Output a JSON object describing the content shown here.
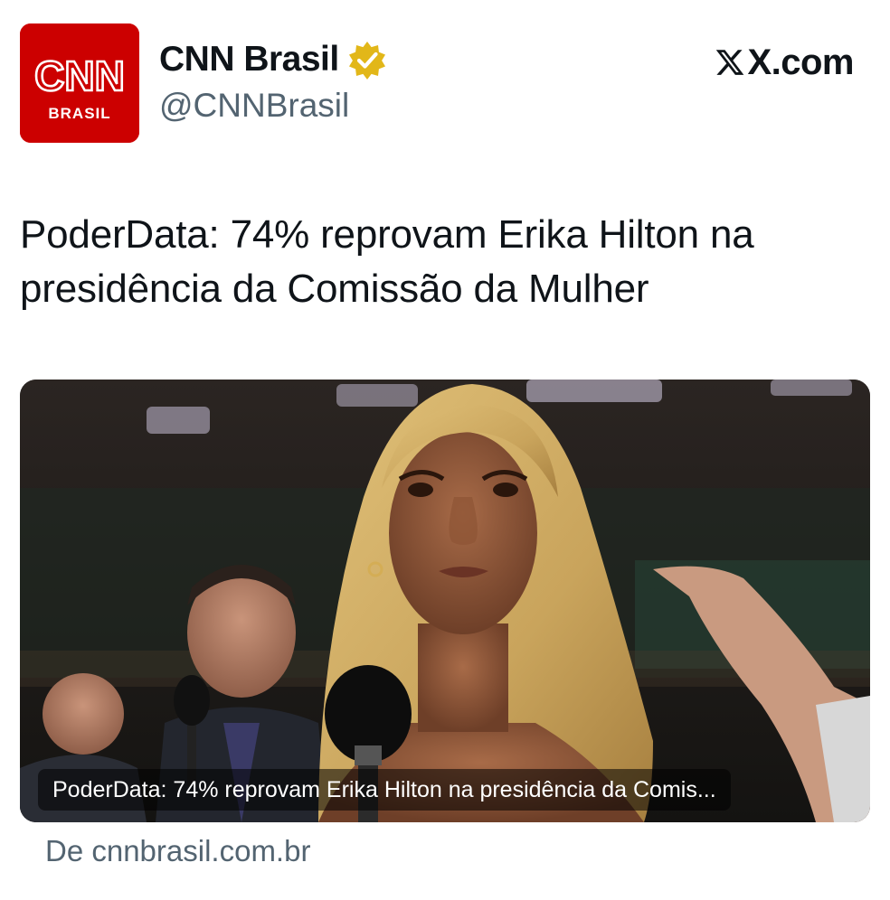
{
  "post": {
    "author_name": "CNN Brasil",
    "author_handle": "@CNNBrasil",
    "platform": "X.com",
    "headline": "PoderData: 74% reprovam Erika Hilton na presidência da Comissão da Mulher"
  },
  "logo": {
    "primary": "CNN",
    "secondary": "BRASIL",
    "color": "#cc0000"
  },
  "link_card": {
    "caption": "PoderData: 74% reprovam Erika Hilton na presidência da Comis...",
    "source": "De cnnbrasil.com.br"
  },
  "icons": {
    "verified": "verified-badge-icon",
    "x_logo": "x-logo-icon"
  },
  "colors": {
    "verified_gold": "#e2b719",
    "secondary_text": "#536471",
    "primary_text": "#0f1419"
  }
}
